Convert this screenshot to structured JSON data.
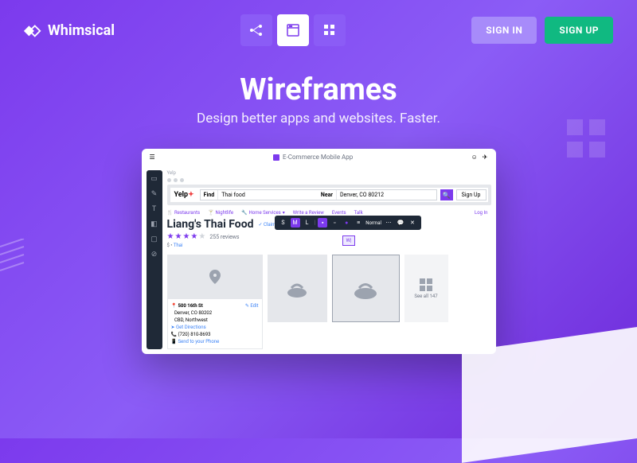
{
  "brand": "Whimsical",
  "nav": {
    "signin": "SIGN IN",
    "signup": "SIGN UP"
  },
  "hero": {
    "title": "Wireframes",
    "subtitle": "Design better apps and websites. Faster."
  },
  "wf": {
    "doc_title": "E-Commerce Mobile App",
    "yelp": {
      "logo": "Yelp",
      "find_label": "Find",
      "find_value": "Thai food",
      "near_label": "Near",
      "near_value": "Denver, CO 80212",
      "signup": "Sign Up",
      "login": "Log In",
      "nav": {
        "restaurants": "Restaurants",
        "nightlife": "Nightlife",
        "home": "Home Services",
        "review": "Write a Review",
        "events": "Events",
        "talk": "Talk"
      }
    },
    "restaurant": {
      "name": "Liang's Thai Food",
      "claimed": "Claimed",
      "reviews": "255 reviews",
      "price": "$",
      "category": "Thai",
      "selection": "W|"
    },
    "toolbar": {
      "s": "S",
      "m": "M",
      "l": "L",
      "normal": "Normal"
    },
    "address": {
      "street": "500 16th St",
      "city": "Denver, CO 80202",
      "area": "CBD, Northwest",
      "directions": "Get Directions",
      "phone": "(720) 810-8693",
      "send": "Send to your Phone",
      "edit": "Edit"
    },
    "seeall": "See all 147"
  }
}
